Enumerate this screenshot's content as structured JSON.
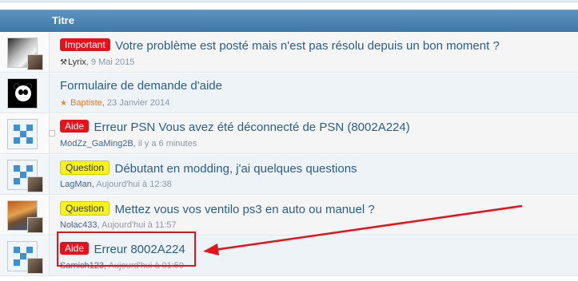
{
  "header": {
    "column_title": "Titre"
  },
  "threads": [
    {
      "prefix": "Important",
      "prefix_color": "#e8101a",
      "title": "Votre problème est posté mais n'est pas résolu depuis un bon moment ?",
      "author": "Lyrix",
      "date": "9 Mai 2015",
      "marker_icon": "hammer-icon"
    },
    {
      "prefix": "",
      "title": "Formulaire de demande d'aide",
      "author": "Baptiste",
      "date": "23 Janvier 2014",
      "marker_icon": "star-icon"
    },
    {
      "prefix": "Aide",
      "prefix_color": "#e8101a",
      "title": "Erreur PSN Vous avez été déconnecté de PSN (8002A224)",
      "author": "ModZz_GaMing2B",
      "date": "il y a 6 minutes"
    },
    {
      "prefix": "Question",
      "prefix_color": "#f7f21a",
      "title": "Débutant en modding, j'ai quelques questions",
      "author": "LagMan",
      "date": "Aujourd'hui à 12:38"
    },
    {
      "prefix": "Question",
      "prefix_color": "#f7f21a",
      "title": "Mettez vous vos ventilo ps3 en auto ou manuel ?",
      "author": "Nolac433",
      "date": "Aujourd'hui à 11:57"
    },
    {
      "prefix": "Aide",
      "prefix_color": "#e8101a",
      "title": "Erreur 8002A224",
      "author": "Samich123",
      "date": "Aujourd'hui à 01:59"
    }
  ],
  "annotation_color": "#e5141c"
}
